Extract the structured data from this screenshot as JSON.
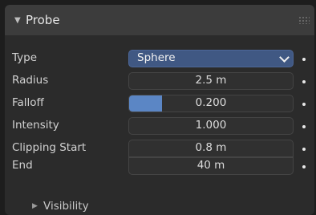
{
  "panel": {
    "title": "Probe",
    "expanded": true
  },
  "rows": [
    {
      "label": "Type",
      "value": "Sphere"
    },
    {
      "label": "Radius",
      "value": "2.5 m"
    },
    {
      "label": "Falloff",
      "value": "0.200",
      "fill_fraction": 0.2
    },
    {
      "label": "Intensity",
      "value": "1.000"
    },
    {
      "label": "Clipping Start",
      "value": "0.8 m"
    },
    {
      "label": "End",
      "value": "40 m"
    }
  ],
  "subpanel": {
    "title": "Visibility",
    "expanded": false
  },
  "colors": {
    "select_bg": "#405883",
    "slider_fill": "#5b86c5",
    "panel_bg": "#2b2b2b",
    "header_bg": "#3c3c3c"
  },
  "icons": {
    "panel_arrow": "disclosure-triangle-down-icon",
    "type_dropdown": "chevron-down-icon",
    "sub_arrow": "disclosure-triangle-right-icon"
  }
}
